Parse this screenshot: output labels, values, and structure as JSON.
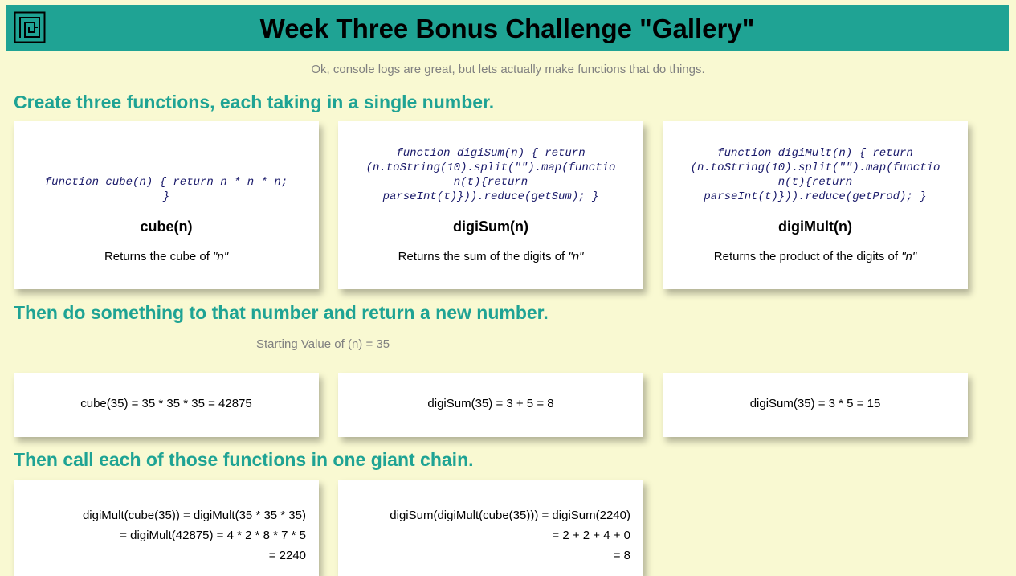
{
  "header": {
    "title": "Week Three Bonus Challenge \"Gallery\"",
    "logo_icon": "maze-logo-icon",
    "background": "#1fa394"
  },
  "subtitle": "Ok, console logs are great, but lets actually make functions that do things.",
  "colors": {
    "page_background": "#f9f9d2",
    "accent": "#1fa394",
    "muted_text": "#808080"
  },
  "section1": {
    "heading": "Create three functions, each taking in a single number.",
    "cards": [
      {
        "code_lines": [
          "function cube(n) { return n * n * n;",
          "}"
        ],
        "name": "cube(n)",
        "desc_prefix": "Returns the cube of ",
        "desc_var": "\"n\""
      },
      {
        "code_lines": [
          "function digiSum(n) { return",
          "(n.toString(10).split(\"\").map(functio",
          "n(t){return",
          "parseInt(t)})).reduce(getSum); }"
        ],
        "name": "digiSum(n)",
        "desc_prefix": "Returns the sum of the digits of ",
        "desc_var": "\"n\""
      },
      {
        "code_lines": [
          "function digiMult(n) { return",
          "(n.toString(10).split(\"\").map(functio",
          "n(t){return",
          "parseInt(t)})).reduce(getProd); }"
        ],
        "name": "digiMult(n)",
        "desc_prefix": "Returns the product of the digits of ",
        "desc_var": "\"n\""
      }
    ]
  },
  "section2": {
    "heading": "Then do something to that number and return a new number.",
    "starting_value": "Starting Value of (n) = 35",
    "results": [
      "cube(35) = 35 * 35 * 35 = 42875",
      "digiSum(35) = 3 + 5 = 8",
      "digiSum(35) = 3 * 5 = 15"
    ]
  },
  "section3": {
    "heading": "Then call each of those functions in one giant chain.",
    "chains": [
      {
        "lines": [
          "digiMult(cube(35)) = digiMult(35 * 35 * 35)",
          "= digiMult(42875) = 4 * 2 * 8 * 7 * 5",
          "= 2240"
        ]
      },
      {
        "lines": [
          "digiSum(digiMult(cube(35))) = digiSum(2240)",
          "= 2 + 2 + 4 + 0",
          "= 8"
        ]
      }
    ]
  }
}
